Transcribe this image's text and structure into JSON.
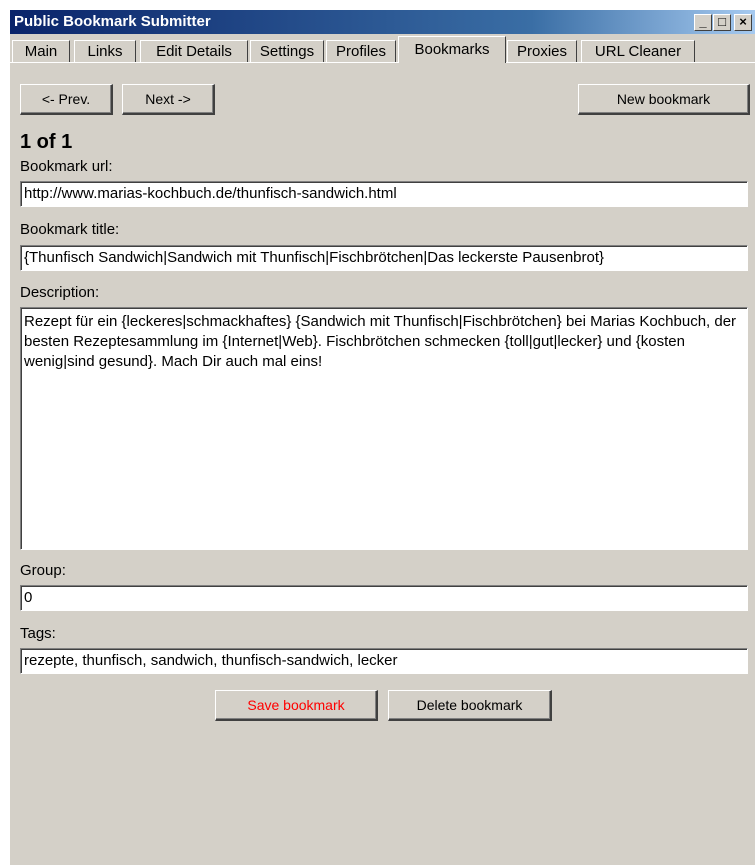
{
  "window": {
    "title": "Public Bookmark Submitter",
    "minimize_glyph": "_",
    "maximize_glyph": "□",
    "close_glyph": "×"
  },
  "tabs": [
    {
      "label": "Main"
    },
    {
      "label": "Links"
    },
    {
      "label": "Edit Details"
    },
    {
      "label": "Settings"
    },
    {
      "label": "Profiles"
    },
    {
      "label": "Bookmarks",
      "active": true
    },
    {
      "label": "Proxies"
    },
    {
      "label": "URL Cleaner"
    }
  ],
  "nav": {
    "prev_label": "<- Prev.",
    "next_label": "Next ->",
    "new_label": "New bookmark",
    "counter": "1 of 1"
  },
  "form": {
    "url_label": "Bookmark url:",
    "url_value": "http://www.marias-kochbuch.de/thunfisch-sandwich.html",
    "title_label": "Bookmark title:",
    "title_value": "{Thunfisch Sandwich|Sandwich mit Thunfisch|Fischbrötchen|Das leckerste Pausenbrot}",
    "description_label": "Description:",
    "description_value": "Rezept für ein {leckeres|schmackhaftes} {Sandwich mit Thunfisch|Fischbrötchen} bei Marias Kochbuch, der besten Rezeptesammlung im {Internet|Web}.  Fischbrötchen schmecken {toll|gut|lecker} und {kosten wenig|sind gesund}. Mach Dir auch mal eins!",
    "group_label": "Group:",
    "group_value": "0",
    "tags_label": "Tags:",
    "tags_value": "rezepte, thunfisch, sandwich, thunfisch-sandwich, lecker"
  },
  "actions": {
    "save_label": "Save bookmark",
    "save_color": "#ff0000",
    "delete_label": "Delete bookmark"
  },
  "colors": {
    "window_bg": "#d4d0c8",
    "titlebar_start": "#0a246a",
    "titlebar_end": "#a6caf0"
  }
}
